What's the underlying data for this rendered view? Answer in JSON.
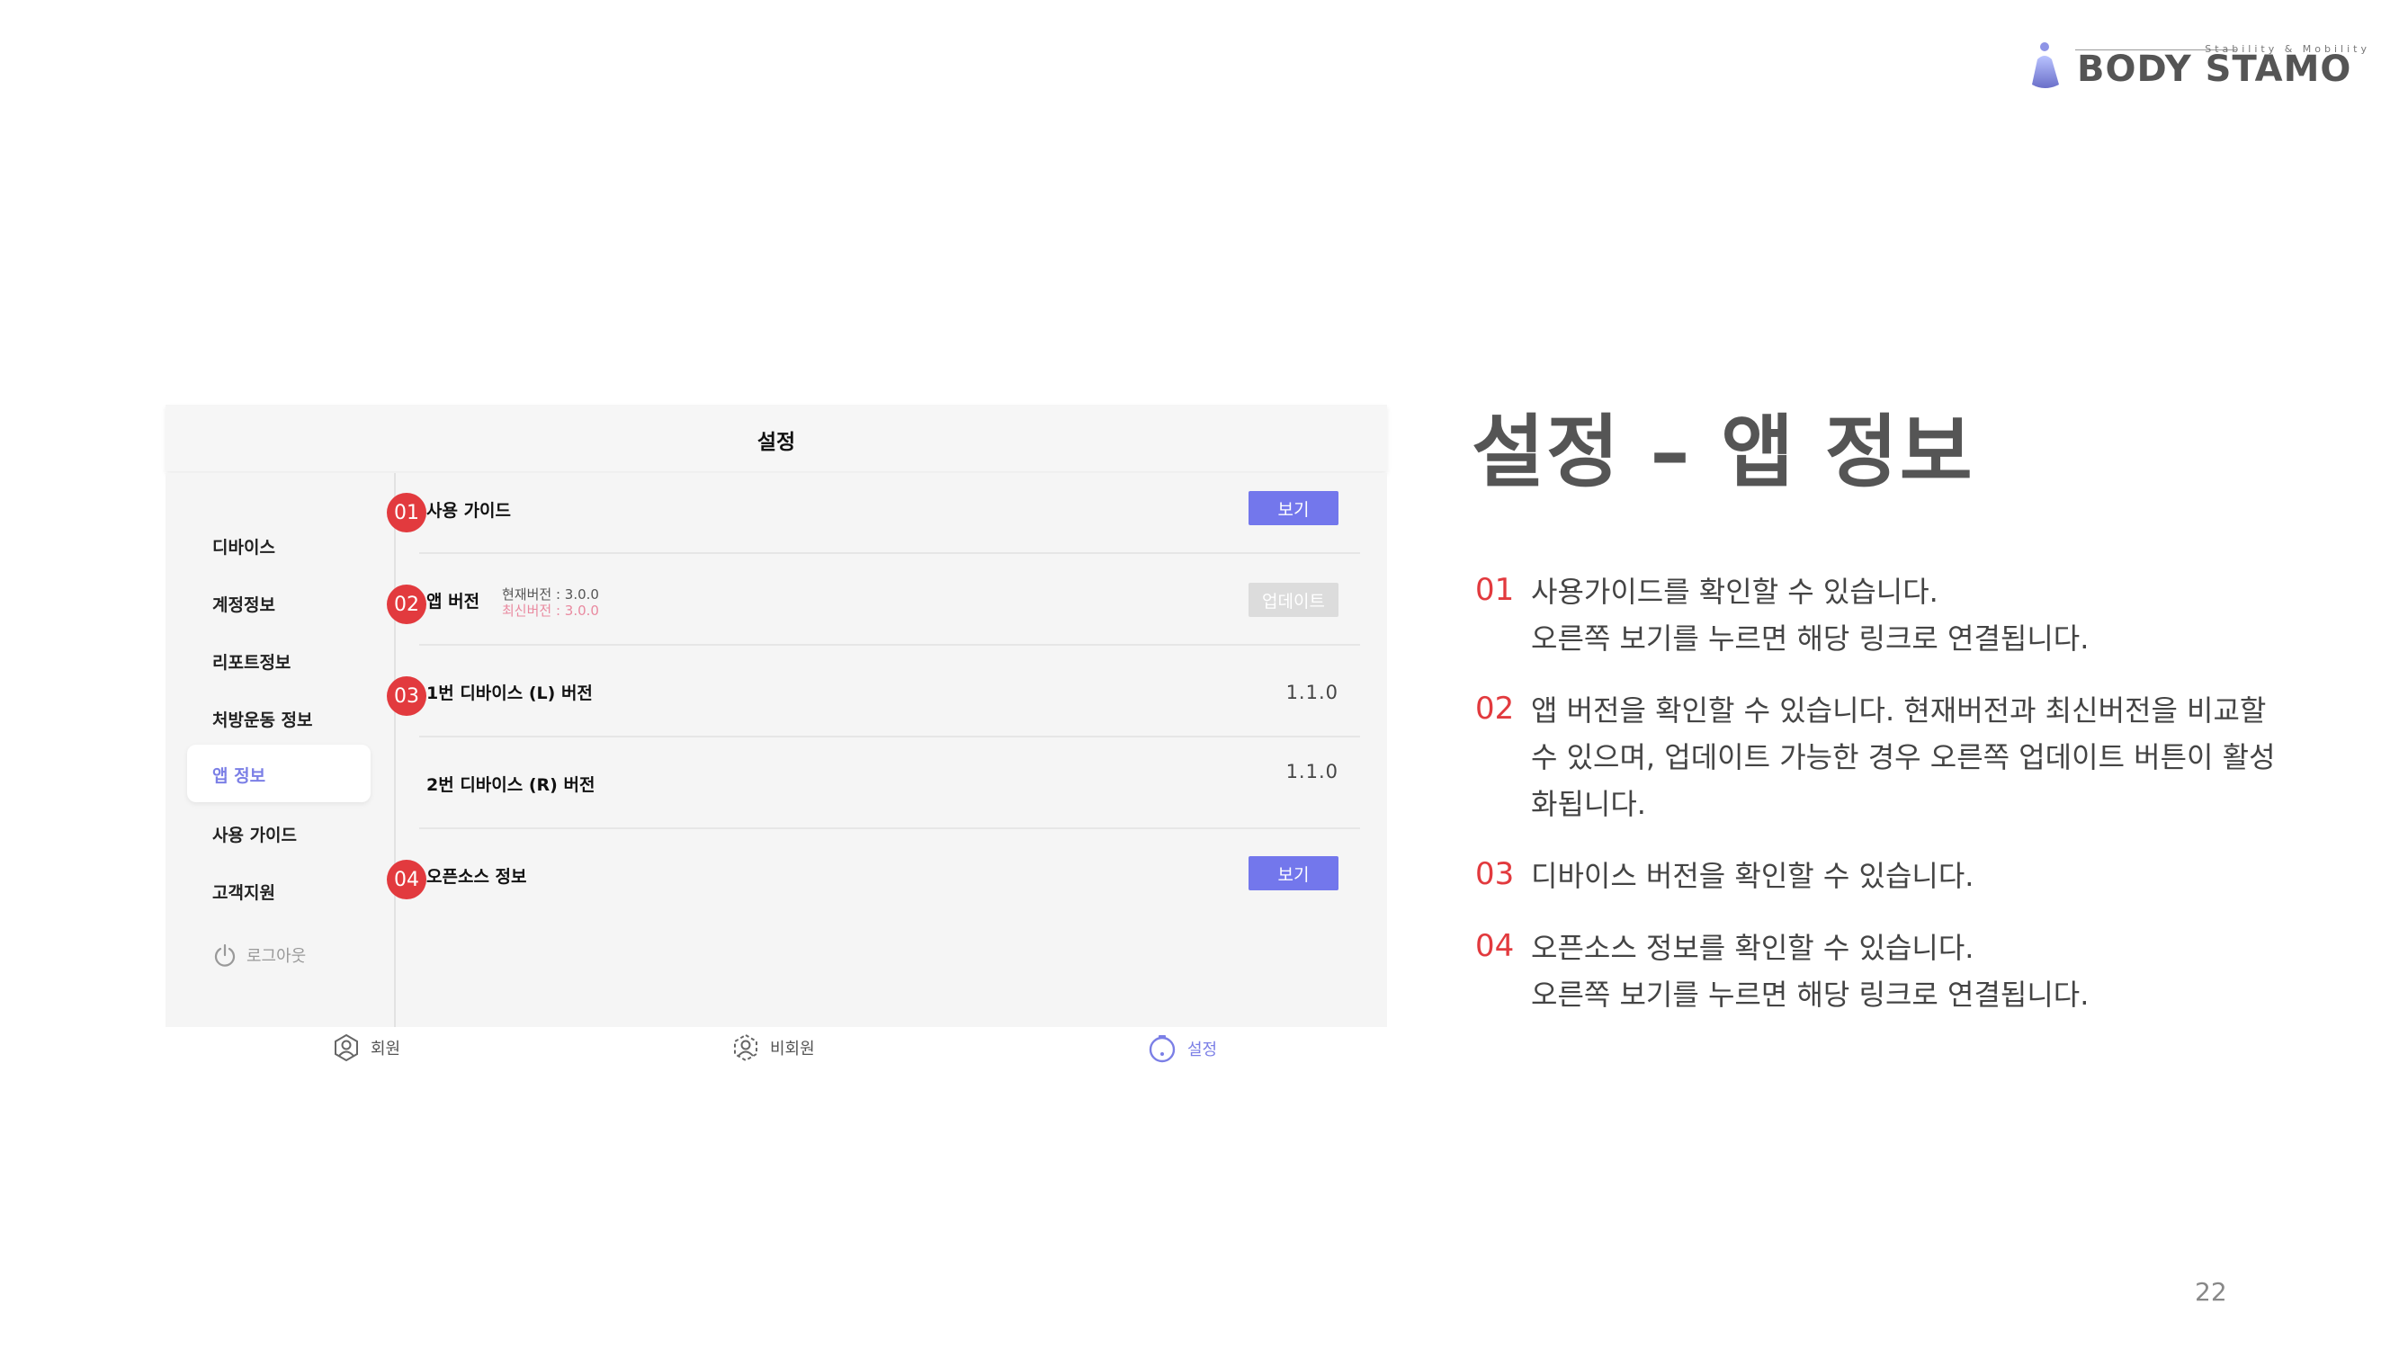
{
  "logo": {
    "tagline": "Stability & Mobility",
    "name": "BODY STAMO"
  },
  "app": {
    "title": "설정",
    "sidebar": {
      "items": [
        {
          "label": "디바이스"
        },
        {
          "label": "계정정보"
        },
        {
          "label": "리포트정보"
        },
        {
          "label": "처방운동 정보"
        },
        {
          "label": "앱 정보",
          "active": true
        },
        {
          "label": "사용 가이드"
        },
        {
          "label": "고객지원"
        }
      ],
      "logout_label": "로그아웃"
    },
    "rows": {
      "guide": {
        "badge": "01",
        "label": "사용 가이드",
        "button": "보기"
      },
      "app_version": {
        "badge": "02",
        "label": "앱 버전",
        "current": "현재버전 : 3.0.0",
        "latest": "최신버전 : 3.0.0",
        "button": "업데이트"
      },
      "device_l": {
        "badge": "03",
        "label": "1번 디바이스 (L) 버전",
        "value": "1.1.0"
      },
      "device_r": {
        "label": "2번 디바이스 (R) 버전",
        "value": "1.1.0"
      },
      "opensource": {
        "badge": "04",
        "label": "오픈소스 정보",
        "button": "보기"
      }
    },
    "tabs": [
      {
        "label": "회원",
        "icon": "member-icon"
      },
      {
        "label": "비회원",
        "icon": "guest-icon"
      },
      {
        "label": "설정",
        "icon": "settings-icon",
        "active": true
      }
    ],
    "colors": {
      "accent": "#7377ec",
      "badge": "#e23a3e",
      "disabled": "#dcdcdc"
    }
  },
  "panel": {
    "heading": "설정 – 앱 정보",
    "items": [
      {
        "num": "01",
        "line1": "사용가이드를 확인할 수 있습니다.",
        "line2": "오른쪽 보기를 누르면 해당 링크로 연결됩니다."
      },
      {
        "num": "02",
        "line1": "앱 버전을 확인할 수 있습니다. 현재버전과 최신버전을 비교할",
        "line2": "수 있으며, 업데이트 가능한 경우 오른쪽 업데이트 버튼이 활성",
        "line3": "화됩니다."
      },
      {
        "num": "03",
        "line1": "디바이스 버전을 확인할 수 있습니다."
      },
      {
        "num": "04",
        "line1": "오픈소스 정보를 확인할 수 있습니다.",
        "line2": "오른쪽 보기를 누르면 해당 링크로 연결됩니다."
      }
    ]
  },
  "page_number": "22"
}
